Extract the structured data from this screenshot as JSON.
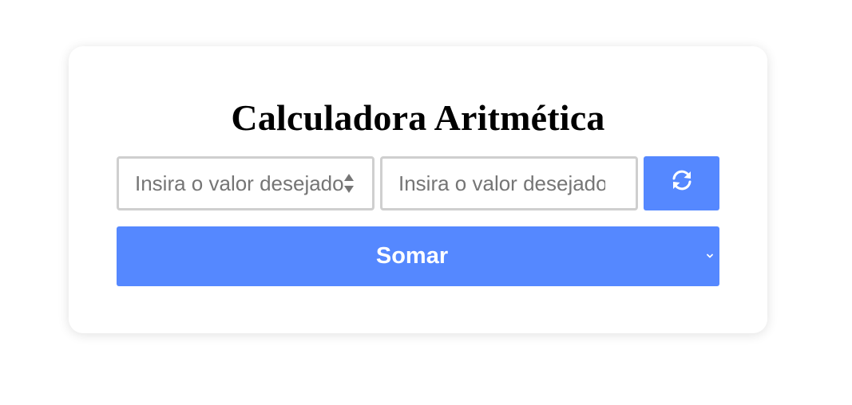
{
  "card": {
    "title": "Calculadora Aritmética"
  },
  "inputs": {
    "first": {
      "placeholder": "Insira o valor desejado",
      "value": ""
    },
    "second": {
      "placeholder": "Insira o valor desejado",
      "value": ""
    }
  },
  "refresh_button": {
    "icon": "refresh-icon"
  },
  "operation_select": {
    "selected": "Somar",
    "icon": "chevron-down-icon"
  },
  "colors": {
    "accent": "#5588ff",
    "input_border": "#cfcfcf",
    "placeholder": "#757575",
    "title": "#000000",
    "background": "#ffffff"
  }
}
